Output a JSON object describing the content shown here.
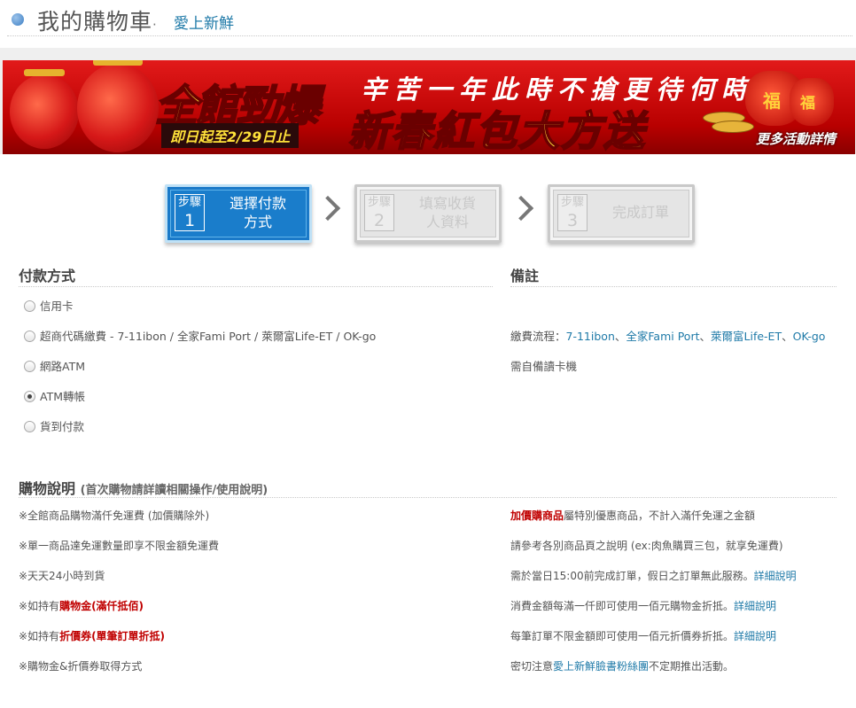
{
  "header": {
    "title": "我的購物車",
    "sep": "‧",
    "brand": "愛上新鮮"
  },
  "banner": {
    "big_left": "全館勁爆",
    "top_right": "辛苦一年此時不搶更待何時",
    "big_right": "新春紅包大方送",
    "date": "即日起至2/29日止",
    "more": "更多活動詳情",
    "bag_text": "福"
  },
  "steps": [
    {
      "tag": "步驟",
      "num": "1",
      "label_1": "選擇付款",
      "label_2": "方式"
    },
    {
      "tag": "步驟",
      "num": "2",
      "label_1": "填寫收貨",
      "label_2": "人資料"
    },
    {
      "tag": "步驟",
      "num": "3",
      "label_1": "完成訂單",
      "label_2": ""
    }
  ],
  "payment": {
    "heading": "付款方式",
    "notes_heading": "備註",
    "options": [
      {
        "label": "信用卡",
        "selected": false
      },
      {
        "label": "超商代碼繳費 - 7-11ibon / 全家Fami Port / 萊爾富Life-ET / OK-go",
        "selected": false
      },
      {
        "label": "網路ATM",
        "selected": false
      },
      {
        "label": "ATM轉帳",
        "selected": true
      },
      {
        "label": "貨到付款",
        "selected": false
      }
    ],
    "notes": {
      "flow_prefix": "繳費流程：",
      "links": [
        "7-11ibon",
        "全家Fami Port",
        "萊爾富Life-ET",
        "OK-go"
      ],
      "sep": "、",
      "atm_note": "需自備讀卡機"
    }
  },
  "instructions": {
    "heading": "購物說明",
    "subheading": "(首次購物請詳讀相關操作/使用說明)",
    "left": {
      "l1": "※全館商品購物滿仟免運費 (加價購除外)",
      "l2": "※單一商品達免運數量即享不限金額免運費",
      "l3": "※天天24小時到貨",
      "l4_prefix": "※如持有",
      "l4_red": "購物金(滿仟抵佰)",
      "l5_prefix": "※如持有",
      "l5_red": "折價券(單筆訂單折抵)",
      "l6": "※購物金&折價券取得方式"
    },
    "right": {
      "r1_red": "加價購商品",
      "r1_rest": "屬特別優惠商品，不計入滿仟免運之金額",
      "r2": "請參考各別商品頁之說明 (ex:肉魚購買三包，就享免運費)",
      "r3": "需於當日15:00前完成訂單，假日之訂單無此服務。",
      "r3_link": "詳細說明",
      "r4": "消費金額每滿一仟即可使用一佰元購物金折抵。",
      "r4_link": "詳細說明",
      "r5": "每筆訂單不限金額即可使用一佰元折價券折抵。",
      "r5_link": "詳細說明",
      "r6_prefix": "密切注意",
      "r6_link": "愛上新鮮臉書粉絲團",
      "r6_suffix": "不定期推出活動。"
    }
  },
  "colors": {
    "accent": "#1f7aa8",
    "step_active": "#1a7dcb",
    "highlight_red": "#c00000",
    "banner_red": "#c40000"
  }
}
